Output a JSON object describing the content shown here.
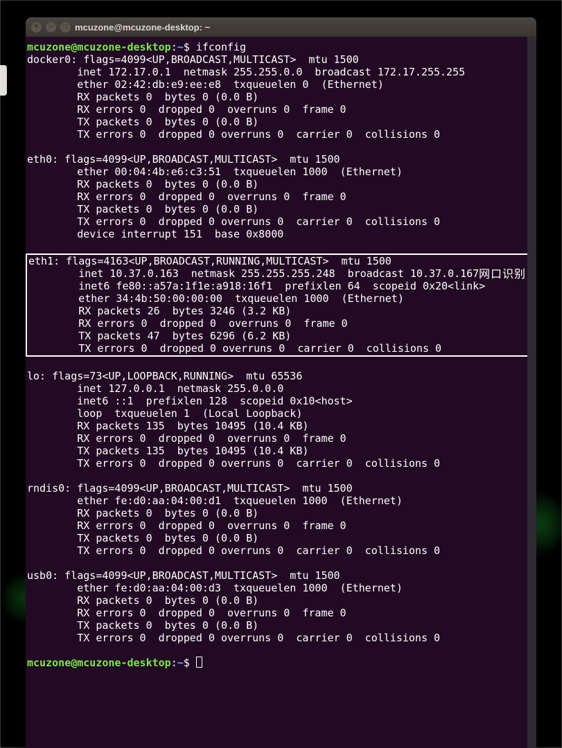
{
  "titlebar": {
    "title": "mcuzone@mcuzone-desktop: ~"
  },
  "prompt": {
    "user": "mcuzone@mcuzone-desktop",
    "path": "~",
    "sep": ":",
    "sym": "$",
    "cmd": "ifconfig"
  },
  "label": "网口识别",
  "ifaces": {
    "docker0": [
      "docker0: flags=4099<UP,BROADCAST,MULTICAST>  mtu 1500",
      "        inet 172.17.0.1  netmask 255.255.0.0  broadcast 172.17.255.255",
      "        ether 02:42:db:e9:ee:e8  txqueuelen 0  (Ethernet)",
      "        RX packets 0  bytes 0 (0.0 B)",
      "        RX errors 0  dropped 0  overruns 0  frame 0",
      "        TX packets 0  bytes 0 (0.0 B)",
      "        TX errors 0  dropped 0 overruns 0  carrier 0  collisions 0"
    ],
    "eth0": [
      "eth0: flags=4099<UP,BROADCAST,MULTICAST>  mtu 1500",
      "        ether 00:04:4b:e6:c3:51  txqueuelen 1000  (Ethernet)",
      "        RX packets 0  bytes 0 (0.0 B)",
      "        RX errors 0  dropped 0  overruns 0  frame 0",
      "        TX packets 0  bytes 0 (0.0 B)",
      "        TX errors 0  dropped 0 overruns 0  carrier 0  collisions 0",
      "        device interrupt 151  base 0x8000"
    ],
    "eth1": [
      "eth1: flags=4163<UP,BROADCAST,RUNNING,MULTICAST>  mtu 1500",
      "        inet 10.37.0.163  netmask 255.255.255.248  broadcast 10.37.0.167",
      "        inet6 fe80::a57a:1f1e:a918:16f1  prefixlen 64  scopeid 0x20<link>",
      "        ether 34:4b:50:00:00:00  txqueuelen 1000  (Ethernet)",
      "        RX packets 26  bytes 3246 (3.2 KB)",
      "        RX errors 0  dropped 0  overruns 0  frame 0",
      "        TX packets 47  bytes 6296 (6.2 KB)",
      "        TX errors 0  dropped 0 overruns 0  carrier 0  collisions 0"
    ],
    "lo": [
      "lo: flags=73<UP,LOOPBACK,RUNNING>  mtu 65536",
      "        inet 127.0.0.1  netmask 255.0.0.0",
      "        inet6 ::1  prefixlen 128  scopeid 0x10<host>",
      "        loop  txqueuelen 1  (Local Loopback)",
      "        RX packets 135  bytes 10495 (10.4 KB)",
      "        RX errors 0  dropped 0  overruns 0  frame 0",
      "        TX packets 135  bytes 10495 (10.4 KB)",
      "        TX errors 0  dropped 0 overruns 0  carrier 0  collisions 0"
    ],
    "rndis0": [
      "rndis0: flags=4099<UP,BROADCAST,MULTICAST>  mtu 1500",
      "        ether fe:d0:aa:04:00:d1  txqueuelen 1000  (Ethernet)",
      "        RX packets 0  bytes 0 (0.0 B)",
      "        RX errors 0  dropped 0  overruns 0  frame 0",
      "        TX packets 0  bytes 0 (0.0 B)",
      "        TX errors 0  dropped 0 overruns 0  carrier 0  collisions 0"
    ],
    "usb0": [
      "usb0: flags=4099<UP,BROADCAST,MULTICAST>  mtu 1500",
      "        ether fe:d0:aa:04:00:d3  txqueuelen 1000  (Ethernet)",
      "        RX packets 0  bytes 0 (0.0 B)",
      "        RX errors 0  dropped 0  overruns 0  frame 0",
      "        TX packets 0  bytes 0 (0.0 B)",
      "        TX errors 0  dropped 0 overruns 0  carrier 0  collisions 0"
    ]
  }
}
